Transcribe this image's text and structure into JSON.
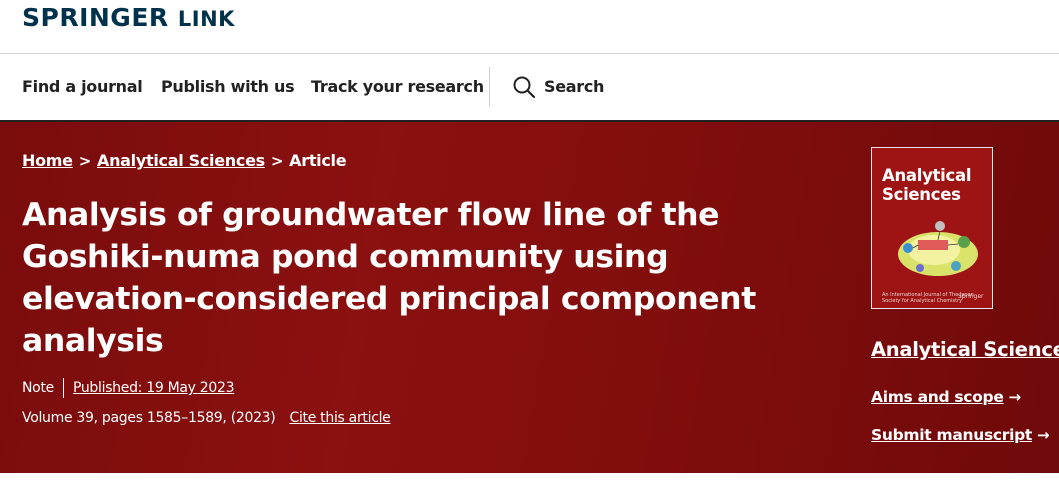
{
  "header": {
    "logo_springer": "SPRINGER",
    "logo_link": "LINK"
  },
  "nav": {
    "find_journal": "Find a journal",
    "publish": "Publish with us",
    "track": "Track your research",
    "search": "Search"
  },
  "breadcrumb": {
    "home": "Home",
    "journal": "Analytical Sciences",
    "current": "Article",
    "separator": ">"
  },
  "article": {
    "title": "Analysis of groundwater flow line of the Goshiki-numa pond community using elevation-considered principal component analysis",
    "type": "Note",
    "published": "Published: 19 May 2023",
    "volume_info": "Volume 39, pages 1585–1589, (2023)",
    "cite": "Cite this article"
  },
  "sidebar": {
    "cover_title": "Analytical Sciences",
    "cover_footer": "An International Journal of The Japan Society for Analytical Chemistry",
    "cover_publisher": "Springer",
    "journal_name": "Analytical Sciences",
    "aims": "Aims and scope",
    "submit": "Submit manuscript",
    "arrow": "→"
  },
  "colors": {
    "brand": "#01324b",
    "hero_bg": "#7e0c0c",
    "cover_bg": "#9e1414"
  },
  "icons": {
    "search": "search-icon",
    "chevron": "chevron-right-icon",
    "arrow": "arrow-right-icon"
  }
}
